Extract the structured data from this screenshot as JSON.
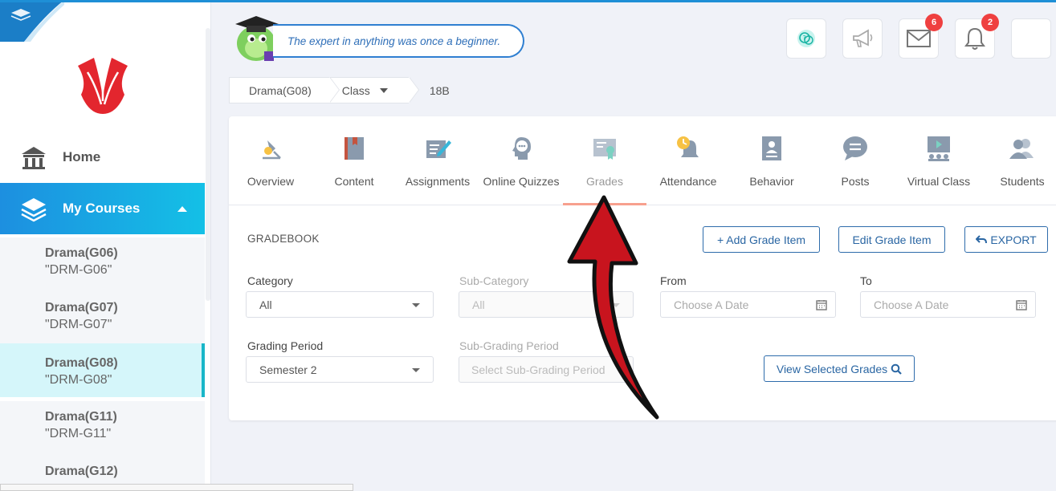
{
  "sidebar": {
    "home_label": "Home",
    "courses_label": "My Courses",
    "courses": [
      {
        "name": "Drama(G06)",
        "code": "\"DRM-G06\""
      },
      {
        "name": "Drama(G07)",
        "code": "\"DRM-G07\""
      },
      {
        "name": "Drama(G08)",
        "code": "\"DRM-G08\""
      },
      {
        "name": "Drama(G11)",
        "code": "\"DRM-G11\""
      },
      {
        "name": "Drama(G12)",
        "code": ""
      }
    ]
  },
  "header": {
    "quote": "The expert in anything was once a beginner.",
    "messages_count": "6",
    "notifications_count": "2"
  },
  "breadcrumb": {
    "course": "Drama(G08)",
    "level": "Class",
    "section": "18B"
  },
  "tabs": [
    "Overview",
    "Content",
    "Assignments",
    "Online Quizzes",
    "Grades",
    "Attendance",
    "Behavior",
    "Posts",
    "Virtual Class",
    "Students"
  ],
  "gradebook": {
    "title": "GRADEBOOK",
    "add_btn": "+ Add Grade Item",
    "edit_btn": "Edit Grade Item",
    "export_btn": "EXPORT",
    "category_label": "Category",
    "category_value": "All",
    "subcategory_label": "Sub-Category",
    "subcategory_value": "All",
    "from_label": "From",
    "from_placeholder": "Choose A Date",
    "to_label": "To",
    "to_placeholder": "Choose A Date",
    "period_label": "Grading Period",
    "period_value": "Semester 2",
    "subperiod_label": "Sub-Grading Period",
    "subperiod_placeholder": "Select Sub-Grading Period",
    "view_btn": "View Selected Grades"
  },
  "colors": {
    "accent": "#1d8fe0",
    "annotation_arrow": "#c8141e"
  }
}
